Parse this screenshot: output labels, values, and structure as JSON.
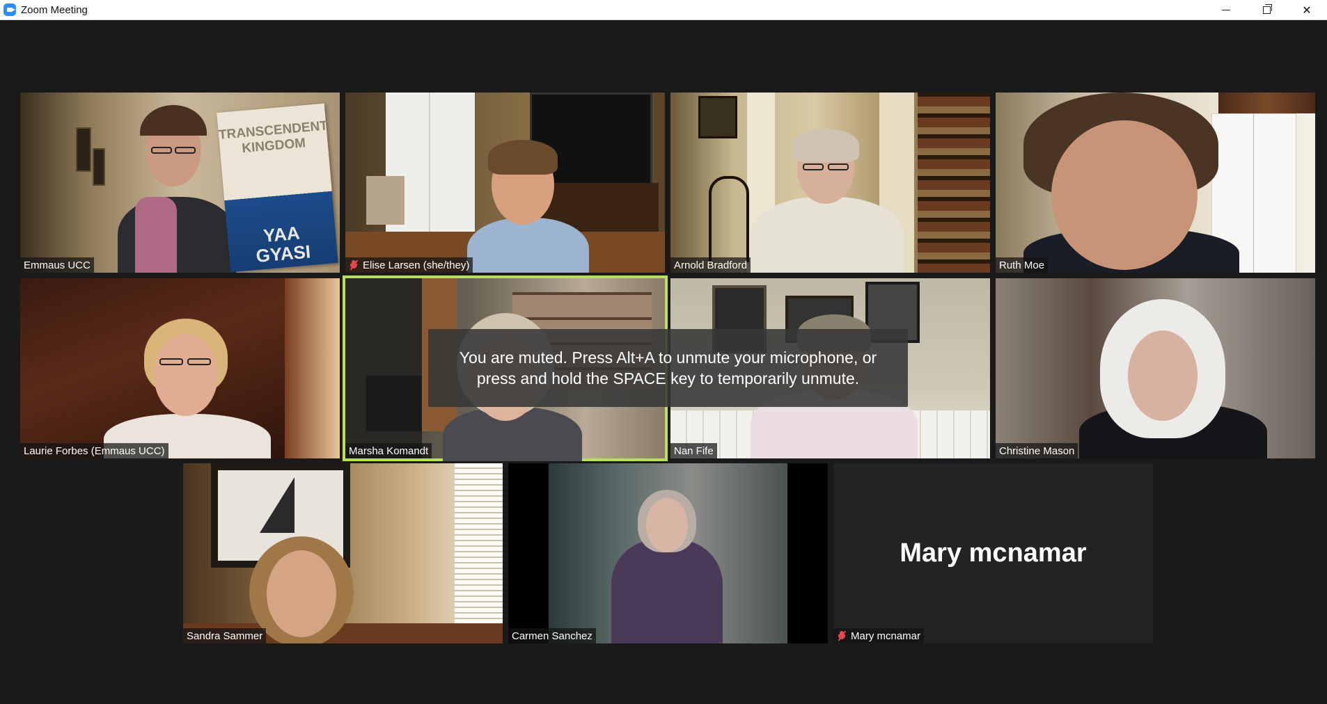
{
  "window": {
    "title": "Zoom Meeting",
    "controls": [
      "minimize",
      "restore",
      "close"
    ]
  },
  "participants": [
    {
      "name": "Emmaus UCC",
      "muted": false,
      "active": false
    },
    {
      "name": "Elise Larsen (she/they)",
      "muted": true,
      "active": false
    },
    {
      "name": "Arnold Bradford",
      "muted": false,
      "active": false
    },
    {
      "name": "Ruth Moe",
      "muted": false,
      "active": false
    },
    {
      "name": "Laurie Forbes (Emmaus UCC)",
      "muted": false,
      "active": false
    },
    {
      "name": "Marsha Komandt",
      "muted": false,
      "active": true
    },
    {
      "name": "Nan Fife",
      "muted": false,
      "active": false
    },
    {
      "name": "Christine Mason",
      "muted": false,
      "active": false
    },
    {
      "name": "Sandra Sammer",
      "muted": false,
      "active": false
    },
    {
      "name": "Carmen Sanchez",
      "muted": false,
      "active": false
    },
    {
      "name": "Mary mcnamar",
      "muted": true,
      "active": false,
      "video_off": true,
      "display_name": "Mary mcnamar"
    }
  ],
  "book": {
    "title": "TRANSCENDENT KINGDOM",
    "author": "YAA GYASI"
  },
  "toast": {
    "line1": "You are muted. Press Alt+A to unmute your microphone, or",
    "line2": "press and hold the SPACE key to temporarily unmute."
  },
  "colors": {
    "background": "#1a1a1a",
    "active_speaker_border": "#b6e25b",
    "muted_icon": "#e5484d",
    "app_icon": "#2d8cff"
  }
}
